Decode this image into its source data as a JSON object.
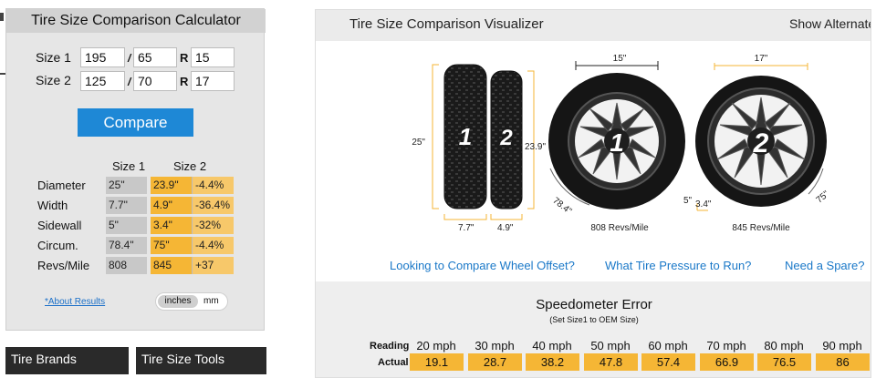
{
  "calculator": {
    "title": "Tire Size Comparison Calculator",
    "size1": {
      "label": "Size 1",
      "width": "195",
      "aspect": "65",
      "rim": "15"
    },
    "size2": {
      "label": "Size 2",
      "width": "125",
      "aspect": "70",
      "rim": "17"
    },
    "separator": "/",
    "rim_prefix": "R",
    "compare_button": "Compare",
    "columns": [
      "Size 1",
      "Size 2"
    ],
    "rows": [
      {
        "label": "Diameter",
        "size1": "25\"",
        "size2": "23.9\"",
        "diff": "-4.4%"
      },
      {
        "label": "Width",
        "size1": "7.7\"",
        "size2": "4.9\"",
        "diff": "-36.4%"
      },
      {
        "label": "Sidewall",
        "size1": "5\"",
        "size2": "3.4\"",
        "diff": "-32%"
      },
      {
        "label": "Circum.",
        "size1": "78.4\"",
        "size2": "75\"",
        "diff": "-4.4%"
      },
      {
        "label": "Revs/Mile",
        "size1": "808",
        "size2": "845",
        "diff": "+37"
      }
    ],
    "about_link": "*About Results",
    "units": {
      "selected": "inches",
      "other": "mm"
    }
  },
  "footer_tabs": [
    "Tire Brands",
    "Tire Size Tools"
  ],
  "visualizer": {
    "title": "Tire Size Comparison Visualizer",
    "alt_link": "Show Alternate",
    "tire1_number": "1",
    "tire2_number": "2",
    "side_view": {
      "height1": "25\"",
      "height2": "23.9\"",
      "width1": "7.7\"",
      "width2": "4.9\""
    },
    "wheel1": {
      "rim": "15\"",
      "circumference": "78.4\"",
      "sidewall": "5\"",
      "revs": "808 Revs/Mile"
    },
    "wheel2": {
      "rim": "17\"",
      "circumference": "75\"",
      "sidewall": "3.4\"",
      "revs": "845 Revs/Mile"
    },
    "links": [
      "Looking to Compare Wheel Offset?",
      "What Tire Pressure to Run?",
      "Need a Spare?"
    ]
  },
  "speedometer": {
    "title": "Speedometer Error",
    "subtitle": "(Set Size1 to OEM Size)",
    "reading_label": "Reading",
    "actual_label": "Actual",
    "readings": [
      "20 mph",
      "30 mph",
      "40 mph",
      "50 mph",
      "60 mph",
      "70 mph",
      "80 mph",
      "90 mph"
    ],
    "actuals": [
      "19.1",
      "28.7",
      "38.2",
      "47.8",
      "57.4",
      "66.9",
      "76.5",
      "86"
    ]
  },
  "colors": {
    "accent": "#1e88d6",
    "highlight": "#f5b635",
    "link": "#1a78c8"
  }
}
